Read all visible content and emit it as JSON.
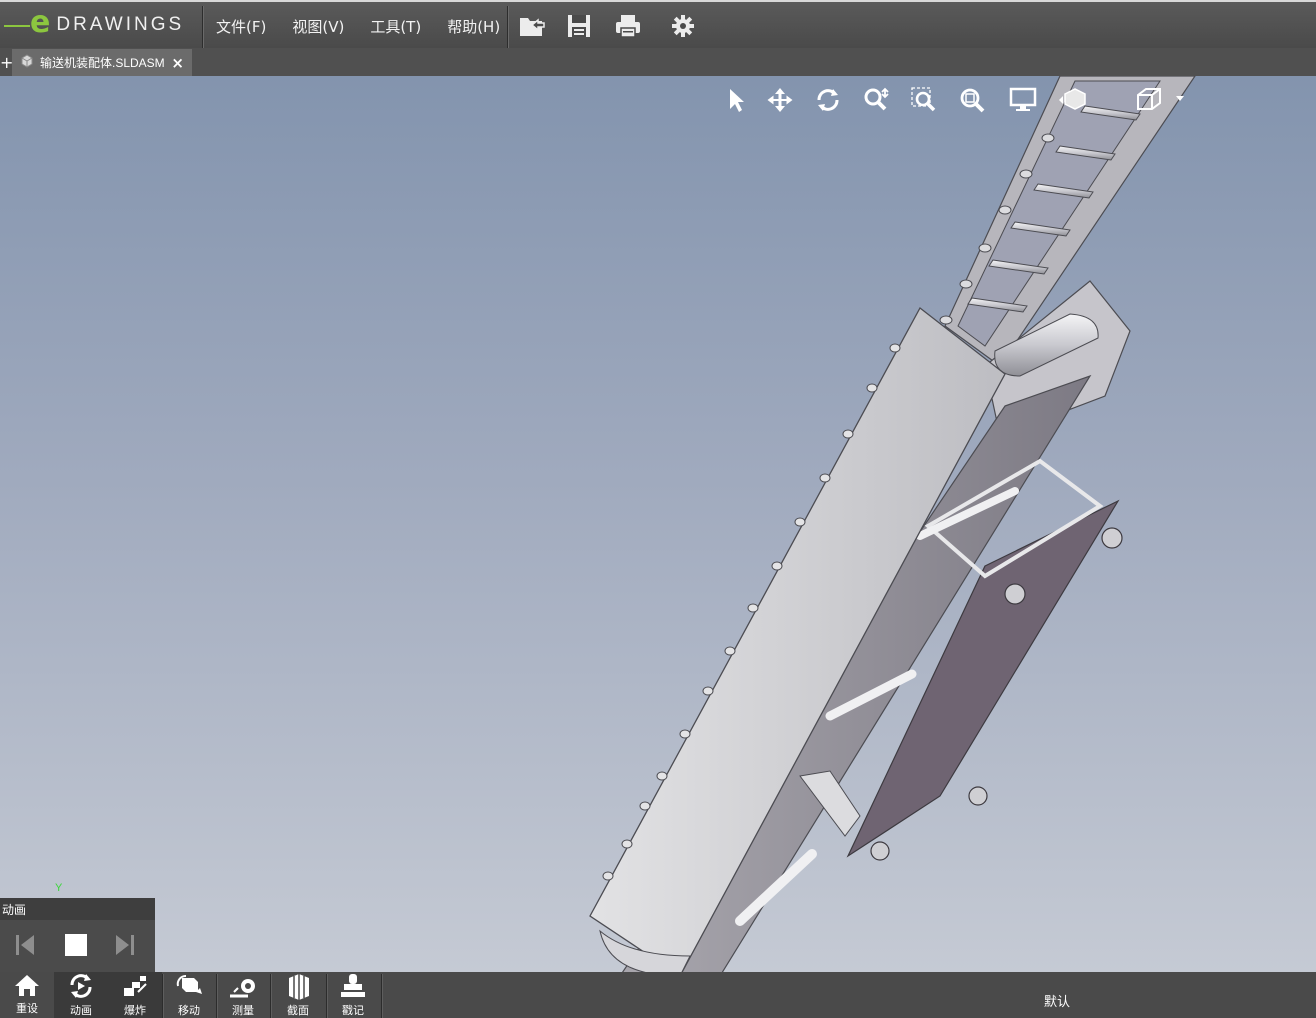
{
  "app": {
    "logo_text": "DRAWINGS",
    "logo_letter": "e"
  },
  "menu": [
    {
      "label": "文件(F)"
    },
    {
      "label": "视图(V)"
    },
    {
      "label": "工具(T)"
    },
    {
      "label": "帮助(H)"
    }
  ],
  "toolbar": {
    "icons": [
      "open-file-icon",
      "save-icon",
      "print-icon",
      "settings-gear-icon"
    ]
  },
  "tabs": {
    "new_tab": "+",
    "active": {
      "label": "输送机装配体.SLDASM",
      "close": "×"
    }
  },
  "view_tools": [
    "select-arrow-icon",
    "pan-icon",
    "rotate-icon",
    "zoom-icon",
    "zoom-to-area-icon",
    "zoom-to-fit-icon",
    "display-mode-icon",
    "hide-show-icon",
    "standard-views-icon"
  ],
  "axis": {
    "y_label": "Y"
  },
  "animation": {
    "title": "动画",
    "controls": [
      "previous-frame-icon",
      "stop-icon",
      "next-frame-icon"
    ]
  },
  "bottom_toolbar": {
    "buttons": [
      {
        "label": "重设",
        "icon": "home-icon"
      },
      {
        "label": "动画",
        "icon": "animation-icon"
      },
      {
        "label": "爆炸",
        "icon": "explode-icon"
      },
      {
        "label": "移动",
        "icon": "move-component-icon"
      },
      {
        "label": "测量",
        "icon": "measure-icon"
      },
      {
        "label": "截面",
        "icon": "section-icon"
      },
      {
        "label": "戳记",
        "icon": "stamp-icon"
      }
    ],
    "configuration": "默认"
  },
  "colors": {
    "accent": "#8cc63f",
    "bar": "#4a4a4a",
    "viewport_top": "#8394ae",
    "viewport_bottom": "#c5cad4"
  }
}
